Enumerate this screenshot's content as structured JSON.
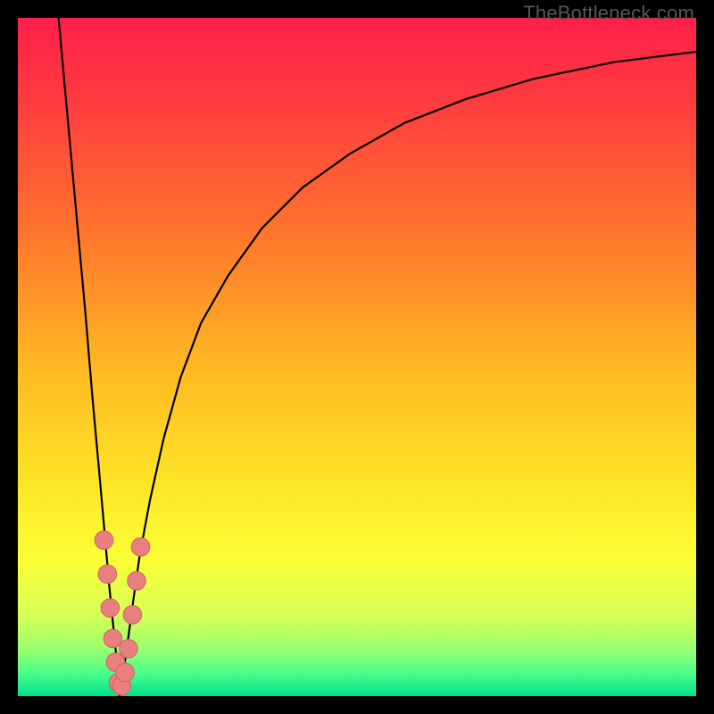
{
  "watermark": "TheBottleneck.com",
  "colors": {
    "frame": "#000000",
    "curve": "#000000",
    "marker_fill": "#e97f7f",
    "marker_stroke": "#d26767",
    "gradient_stops": [
      {
        "offset": 0.0,
        "color": "#ff1f4a"
      },
      {
        "offset": 0.12,
        "color": "#ff3b3f"
      },
      {
        "offset": 0.3,
        "color": "#ff6f2e"
      },
      {
        "offset": 0.5,
        "color": "#ffb423"
      },
      {
        "offset": 0.68,
        "color": "#ffe326"
      },
      {
        "offset": 0.8,
        "color": "#fbff37"
      },
      {
        "offset": 0.88,
        "color": "#d7ff56"
      },
      {
        "offset": 0.93,
        "color": "#9cff70"
      },
      {
        "offset": 0.965,
        "color": "#4dff8a"
      },
      {
        "offset": 1.0,
        "color": "#00e08f"
      }
    ]
  },
  "chart_data": {
    "type": "line",
    "title": "",
    "xlabel": "",
    "ylabel": "",
    "xlim": [
      0,
      100
    ],
    "ylim": [
      0,
      100
    ],
    "notch_x": 15,
    "series": [
      {
        "name": "left-branch",
        "x": [
          6.0,
          7.0,
          8.0,
          9.0,
          10.0,
          11.0,
          12.0,
          12.8,
          13.5,
          14.2,
          14.8,
          15.0
        ],
        "y": [
          100,
          89,
          78,
          67,
          56,
          44,
          33,
          24,
          16,
          9,
          3,
          0
        ]
      },
      {
        "name": "right-branch",
        "x": [
          15.0,
          15.5,
          16.2,
          17.0,
          18.0,
          19.5,
          21.5,
          24.0,
          27.0,
          31.0,
          36.0,
          42.0,
          49.0,
          57.0,
          66.0,
          76.0,
          88.0,
          100.0
        ],
        "y": [
          0,
          3,
          8,
          14,
          21,
          29,
          38,
          47,
          55,
          62,
          69,
          75,
          80,
          84.5,
          88,
          91,
          93.5,
          95
        ]
      }
    ],
    "markers": {
      "name": "highlight-points",
      "points": [
        {
          "x": 12.7,
          "y": 23
        },
        {
          "x": 13.2,
          "y": 18
        },
        {
          "x": 13.6,
          "y": 13
        },
        {
          "x": 14.0,
          "y": 8.5
        },
        {
          "x": 14.4,
          "y": 5
        },
        {
          "x": 14.8,
          "y": 2
        },
        {
          "x": 15.3,
          "y": 1.5
        },
        {
          "x": 15.8,
          "y": 3.5
        },
        {
          "x": 16.3,
          "y": 7
        },
        {
          "x": 16.9,
          "y": 12
        },
        {
          "x": 17.5,
          "y": 17
        },
        {
          "x": 18.1,
          "y": 22
        }
      ]
    }
  }
}
